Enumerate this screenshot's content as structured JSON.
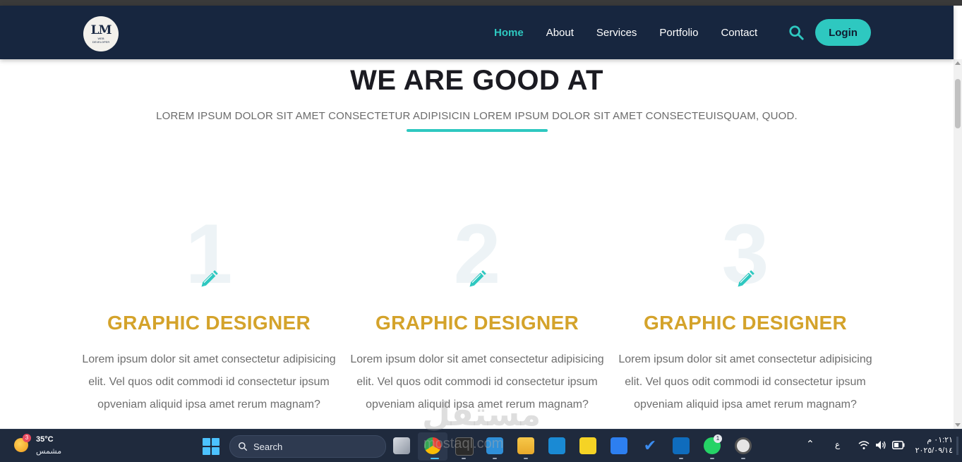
{
  "nav": {
    "logo_mark": "LM",
    "logo_sub": "WEB DEVELOPER",
    "links": [
      "Home",
      "About",
      "Services",
      "Portfolio",
      "Contact"
    ],
    "active_link": "Home",
    "login_label": "Login"
  },
  "section": {
    "title": "WE ARE GOOD AT",
    "subtitle": "LOREM IPSUM DOLOR SIT AMET CONSECTETUR ADIPISICIN LOREM IPSUM DOLOR SIT AMET CONSECTEUISQUAM, QUOD."
  },
  "cards": [
    {
      "number": "1",
      "title": "GRAPHIC DESIGNER",
      "body": "Lorem ipsum dolor sit amet consectetur adipisicing elit. Vel quos odit commodi id consectetur ipsum opveniam aliquid ipsa amet rerum magnam?"
    },
    {
      "number": "2",
      "title": "GRAPHIC DESIGNER",
      "body": "Lorem ipsum dolor sit amet consectetur adipisicing elit. Vel quos odit commodi id consectetur ipsum opveniam aliquid ipsa amet rerum magnam?"
    },
    {
      "number": "3",
      "title": "GRAPHIC DESIGNER",
      "body": "Lorem ipsum dolor sit amet consectetur adipisicing elit. Vel quos odit commodi id consectetur ipsum opveniam aliquid ipsa amet rerum magnam?"
    }
  ],
  "colors": {
    "navbar": "#17263f",
    "accent": "#2ec8c0",
    "card_title": "#d4a32b"
  },
  "taskbar": {
    "weather_badge": "3",
    "temperature": "35°C",
    "condition": "مشمس",
    "search_label": "Search",
    "whatsapp_badge": "1",
    "language": "ع",
    "time": "٠١:٢١ م",
    "date": "٢٠٢٥/٠٩/١٤",
    "apps": [
      "task-view-icon",
      "chrome-icon",
      "terminal-icon",
      "vscode-icon",
      "file-explorer-icon",
      "mail-icon",
      "sticky-notes-icon",
      "calendar-icon",
      "todo-icon",
      "outlook-icon",
      "whatsapp-icon",
      "clock-icon"
    ]
  },
  "watermark": {
    "arabic": "مستقل",
    "latin": "mostaql.com"
  }
}
